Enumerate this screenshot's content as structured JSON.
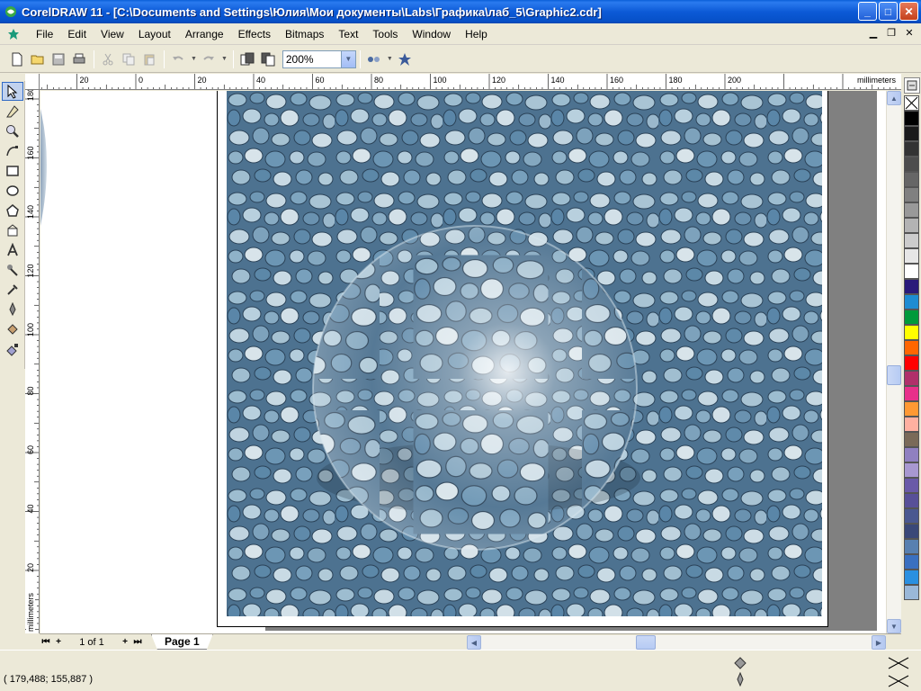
{
  "window": {
    "title": "CorelDRAW 11 - [C:\\Documents and Settings\\Юлия\\Мои документы\\Labs\\Графика\\лаб_5\\Graphic2.cdr]",
    "controls": {
      "minimize": "_",
      "maximize": "□",
      "close": "✕"
    }
  },
  "menu": {
    "items": [
      "File",
      "Edit",
      "View",
      "Layout",
      "Arrange",
      "Effects",
      "Bitmaps",
      "Text",
      "Tools",
      "Window",
      "Help"
    ]
  },
  "toolbar": {
    "zoom_value": "200%"
  },
  "rulers": {
    "units": "millimeters",
    "horizontal_ticks": [
      "40",
      "20",
      "0",
      "20",
      "40",
      "60",
      "80",
      "100",
      "120",
      "140",
      "160",
      "180",
      "200"
    ],
    "vertical_ticks": [
      "180",
      "160",
      "140",
      "120",
      "100",
      "80",
      "60",
      "40",
      "20"
    ]
  },
  "tools": [
    "pick-tool-icon",
    "shape-tool-icon",
    "zoom-tool-icon",
    "curve-tool-icon",
    "rectangle-tool-icon",
    "ellipse-tool-icon",
    "polygon-tool-icon",
    "basic-shapes-tool-icon",
    "text-tool-icon",
    "interactive-tool-icon",
    "eyedropper-tool-icon",
    "outline-tool-icon",
    "fill-tool-icon",
    "interactive-fill-tool-icon"
  ],
  "palette": {
    "colors": [
      "#000000",
      "#1a1a1a",
      "#333333",
      "#4d4d4d",
      "#666666",
      "#808080",
      "#999999",
      "#b3b3b3",
      "#cccccc",
      "#e6e6e6",
      "#ffffff",
      "#2a1a7a",
      "#1e8cd2",
      "#009a3a",
      "#ffff00",
      "#ff6600",
      "#ff0000",
      "#b0306a",
      "#e8308a",
      "#ff9933",
      "#ffb0a0",
      "#7a6a58",
      "#9080c0",
      "#a898d0",
      "#6a5aa8",
      "#585098",
      "#4a5890",
      "#3a4878",
      "#5880b0",
      "#3a70c0",
      "#2a90e0",
      "#9ab8d8"
    ]
  },
  "navigator": {
    "page_count": "1 of 1",
    "page_tab": "Page 1"
  },
  "status": {
    "coordinates": "( 179,488; 155,887 )"
  }
}
